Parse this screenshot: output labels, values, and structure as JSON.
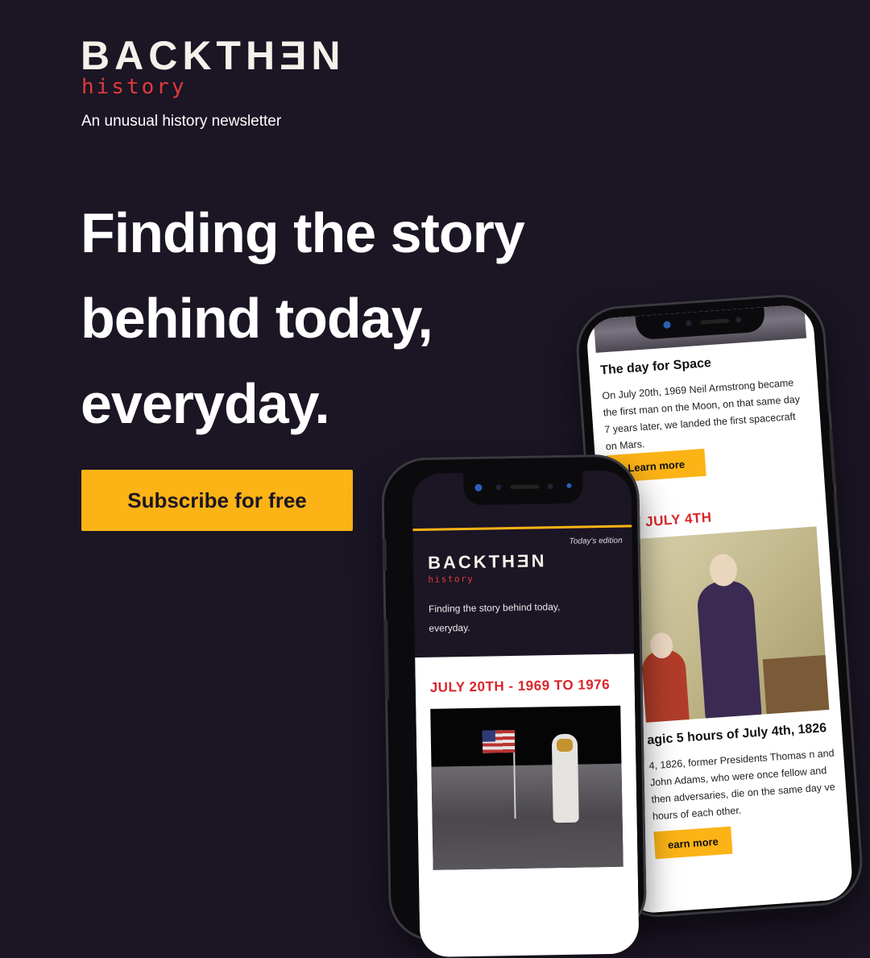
{
  "brand": {
    "name": "BACKTHƎN",
    "sub": "history",
    "tagline": "An unusual history newsletter"
  },
  "hero": {
    "headline_lines": [
      "Finding the story",
      "behind today,",
      "everyday."
    ],
    "cta_label": "Subscribe for free"
  },
  "colors": {
    "background": "#1b1524",
    "accent_yellow": "#fcb316",
    "accent_red": "#d9262b"
  },
  "front_phone": {
    "edition_label": "Today's edition",
    "logo": "BACKTHƎN",
    "logo_sub": "history",
    "tagline": "Finding the story behind today, everyday.",
    "date_heading": "JULY 20TH - 1969 TO 1976"
  },
  "back_phone": {
    "article1_title": "The day for Space",
    "article1_text": "On July 20th, 1969 Neil Armstrong became the first man on the Moon, on that same day 7 years later, we landed the first spacecraft on Mars.",
    "article1_button": "Learn more",
    "section2_heading": "Y JULY 4TH",
    "article2_title": "agic 5 hours of July 4th, 1826",
    "article2_text": "4, 1826, former Presidents Thomas n and John Adams, who were once fellow and then adversaries, die on the same day ve hours of each other.",
    "article2_button": "earn more"
  }
}
